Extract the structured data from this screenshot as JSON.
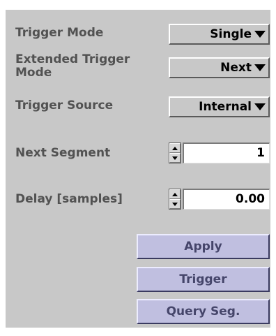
{
  "trigger_mode": {
    "label": "Trigger Mode",
    "value": "Single"
  },
  "extended_trigger_mode": {
    "label": "Extended Trigger Mode",
    "value": "Next"
  },
  "trigger_source": {
    "label": "Trigger Source",
    "value": "Internal"
  },
  "next_segment": {
    "label": "Next Segment",
    "value": "1"
  },
  "delay": {
    "label": "Delay [samples]",
    "value": "0.00"
  },
  "buttons": {
    "apply": "Apply",
    "trigger": "Trigger",
    "query_seg": "Query Seg."
  },
  "colors": {
    "panel": "#c8c8c8",
    "button": "#c0bfe0",
    "label_text": "#525252"
  }
}
